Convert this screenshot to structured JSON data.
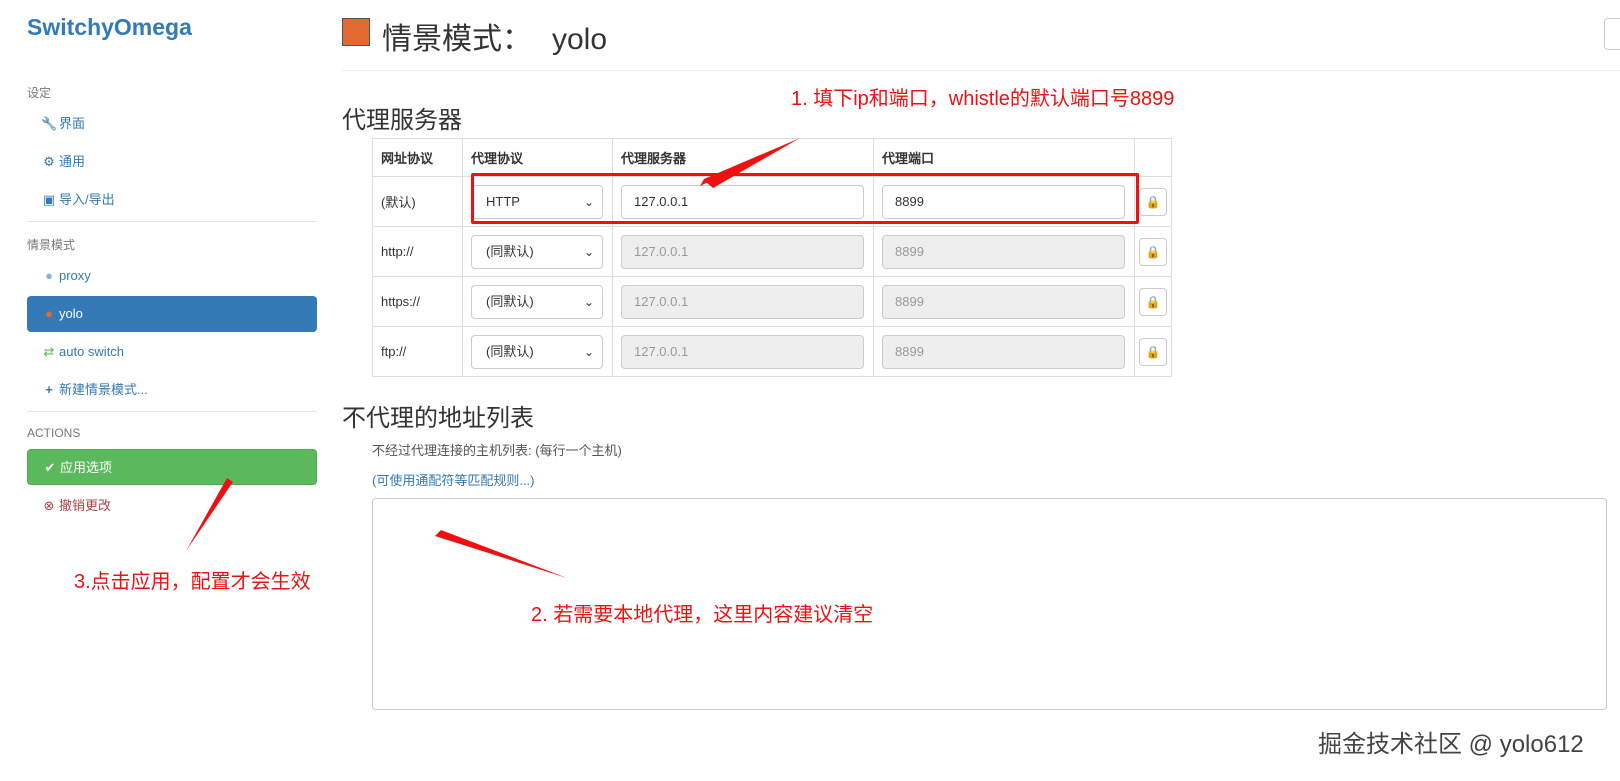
{
  "sidebar": {
    "brand": "SwitchyOmega",
    "settings_header": "设定",
    "settings_items": [
      {
        "label": "界面",
        "icon": "wrench-icon"
      },
      {
        "label": "通用",
        "icon": "gear-icon"
      },
      {
        "label": "导入/导出",
        "icon": "floppy-icon"
      }
    ],
    "profiles_header": "情景模式",
    "profiles": [
      {
        "label": "proxy",
        "icon": "globe-icon"
      },
      {
        "label": "yolo",
        "icon": "globe-icon",
        "active": true
      },
      {
        "label": "auto switch",
        "icon": "switch-icon"
      },
      {
        "label": "新建情景模式...",
        "icon": "plus-icon"
      }
    ],
    "actions_header": "ACTIONS",
    "apply_label": "应用选项",
    "discard_label": "撤销更改"
  },
  "header": {
    "title_prefix": "情景模式：",
    "profile_name": "yolo",
    "swatch_color": "#e06a30"
  },
  "proxy_servers": {
    "heading": "代理服务器",
    "columns": [
      "网址协议",
      "代理协议",
      "代理服务器",
      "代理端口"
    ],
    "rows": [
      {
        "scheme": "(默认)",
        "protocol": "HTTP",
        "server": "127.0.0.1",
        "port": "8899"
      },
      {
        "scheme": "http://",
        "protocol": "(同默认)",
        "server": "127.0.0.1",
        "port": "8899"
      },
      {
        "scheme": "https://",
        "protocol": "(同默认)",
        "server": "127.0.0.1",
        "port": "8899"
      },
      {
        "scheme": "ftp://",
        "protocol": "(同默认)",
        "server": "127.0.0.1",
        "port": "8899"
      }
    ]
  },
  "bypass": {
    "heading": "不代理的地址列表",
    "help": "不经过代理连接的主机列表: (每行一个主机)",
    "link": "(可使用通配符等匹配规则...)",
    "value": ""
  },
  "annotations": {
    "note1": "1. 填下ip和端口，whistle的默认端口号8899",
    "note2": "2. 若需要本地代理，这里内容建议清空",
    "note3": "3.点击应用，配置才会生效",
    "color": "#ee1111"
  },
  "watermark": "掘金技术社区 @ yolo612"
}
